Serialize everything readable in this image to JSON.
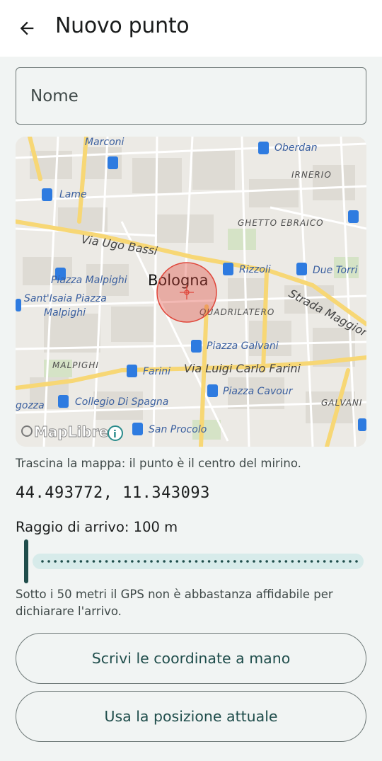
{
  "header": {
    "title": "Nuovo punto",
    "back_icon": "arrow-left-icon"
  },
  "form": {
    "name_placeholder": "Nome",
    "name_value": ""
  },
  "map": {
    "labels": {
      "marconi": "Marconi",
      "oberdan": "Oberdan",
      "irnerio": "IRNERIO",
      "lame": "Lame",
      "ghetto": "GHETTO EBRAICO",
      "ugo_bassi": "Via Ugo Bassi",
      "rizzoli": "Rizzoli",
      "due_torri": "Due Torri",
      "malpighi_piazza": "Piazza Malpighi",
      "santisaia_1": "Sant'Isaia Piazza",
      "santisaia_2": "Malpighi",
      "bologna": "Bologna",
      "quadrilatero": "QUADRILATERO",
      "strada_maggiore": "Strada Maggior",
      "galvani_piazza": "Piazza Galvani",
      "malpighi": "MALPIGHI",
      "farini": "Farini",
      "via_farini": "Via Luigi Carlo Farini",
      "cavour": "Piazza Cavour",
      "galvani": "GALVANI",
      "gozza": "gozza",
      "collegio": "Collegio Di Spagna",
      "san_procolo": "San Procolo",
      "attribution": "MapLibre"
    },
    "colors": {
      "land": "#eceae5",
      "road": "#ffffff",
      "arterial": "#f7d775",
      "bus": "#2e7be0",
      "marker": "#e0463a"
    }
  },
  "hint": "Trascina la mappa: il punto è il centro del mirino.",
  "coordinates": "44.493772, 11.343093",
  "radius": {
    "label_prefix": "Raggio di arrivo: ",
    "value": "100 m",
    "slider_fraction": 0.0
  },
  "note": "Sotto i 50 metri il GPS non è abbastanza affidabile per dichiarare l'arrivo.",
  "buttons": {
    "manual": "Scrivi le coordinate a mano",
    "current": "Usa la posizione attuale"
  }
}
